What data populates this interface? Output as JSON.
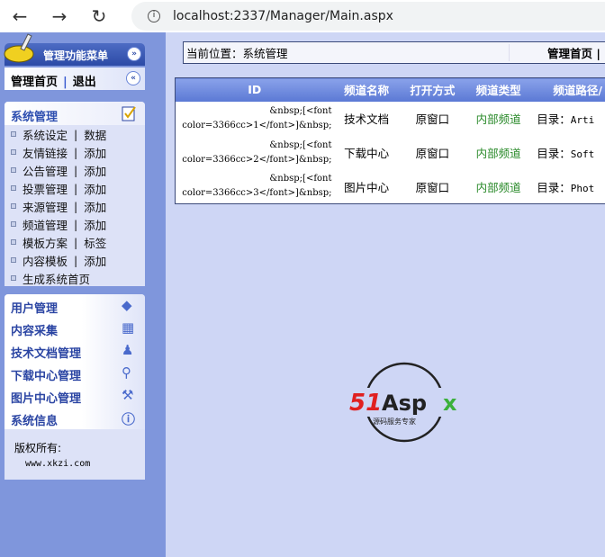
{
  "browser": {
    "url": "localhost:2337/Manager/Main.aspx",
    "icons": [
      "back-arrow-icon",
      "forward-arrow-icon",
      "reload-icon",
      "info-icon"
    ]
  },
  "sidebar": {
    "title": "管理功能菜单",
    "home": "管理首页",
    "sep": "|",
    "logout": "退出",
    "section1": {
      "title": "系统管理",
      "items": [
        {
          "a": "系统设定",
          "b": "数据"
        },
        {
          "a": "友情链接",
          "b": "添加"
        },
        {
          "a": "公告管理",
          "b": "添加"
        },
        {
          "a": "投票管理",
          "b": "添加"
        },
        {
          "a": "来源管理",
          "b": "添加"
        },
        {
          "a": "频道管理",
          "b": "添加"
        },
        {
          "a": "模板方案",
          "b": "标签"
        },
        {
          "a": "内容模板",
          "b": "添加"
        },
        {
          "a": "生成系统首页"
        }
      ]
    },
    "sections": [
      {
        "label": "用户管理"
      },
      {
        "label": "内容采集"
      },
      {
        "label": "技术文档管理"
      },
      {
        "label": "下载中心管理"
      },
      {
        "label": "图片中心管理"
      },
      {
        "label": "系统信息"
      }
    ],
    "copyright": "版权所有:",
    "site": "www.xkzi.com"
  },
  "main": {
    "location": "当前位置：系统管理",
    "home_link": "管理首页 |",
    "columns": [
      "ID",
      "频道名称",
      "打开方式",
      "频道类型",
      "频道路径/"
    ],
    "rows": [
      {
        "id1": "&nbsp;[<font",
        "id2": "color=3366cc>1</font>]&nbsp;",
        "name": "技术文档",
        "open": "原窗口",
        "type": "内部频道",
        "path": "目录：",
        "dir": "Arti"
      },
      {
        "id1": "&nbsp;[<font",
        "id2": "color=3366cc>2</font>]&nbsp;",
        "name": "下载中心",
        "open": "原窗口",
        "type": "内部频道",
        "path": "目录：",
        "dir": "Soft"
      },
      {
        "id1": "&nbsp;[<font",
        "id2": "color=3366cc>3</font>]&nbsp;",
        "name": "图片中心",
        "open": "原窗口",
        "type": "内部频道",
        "path": "目录：",
        "dir": "Phot"
      }
    ],
    "brand": {
      "logo": "51Aspx",
      "tagline": "源码服务专家"
    }
  },
  "colors": {
    "sidebar": "#7f96dc",
    "main": "#ced6f5",
    "header": "#2c4aa6",
    "green": "#2a8a2a"
  }
}
